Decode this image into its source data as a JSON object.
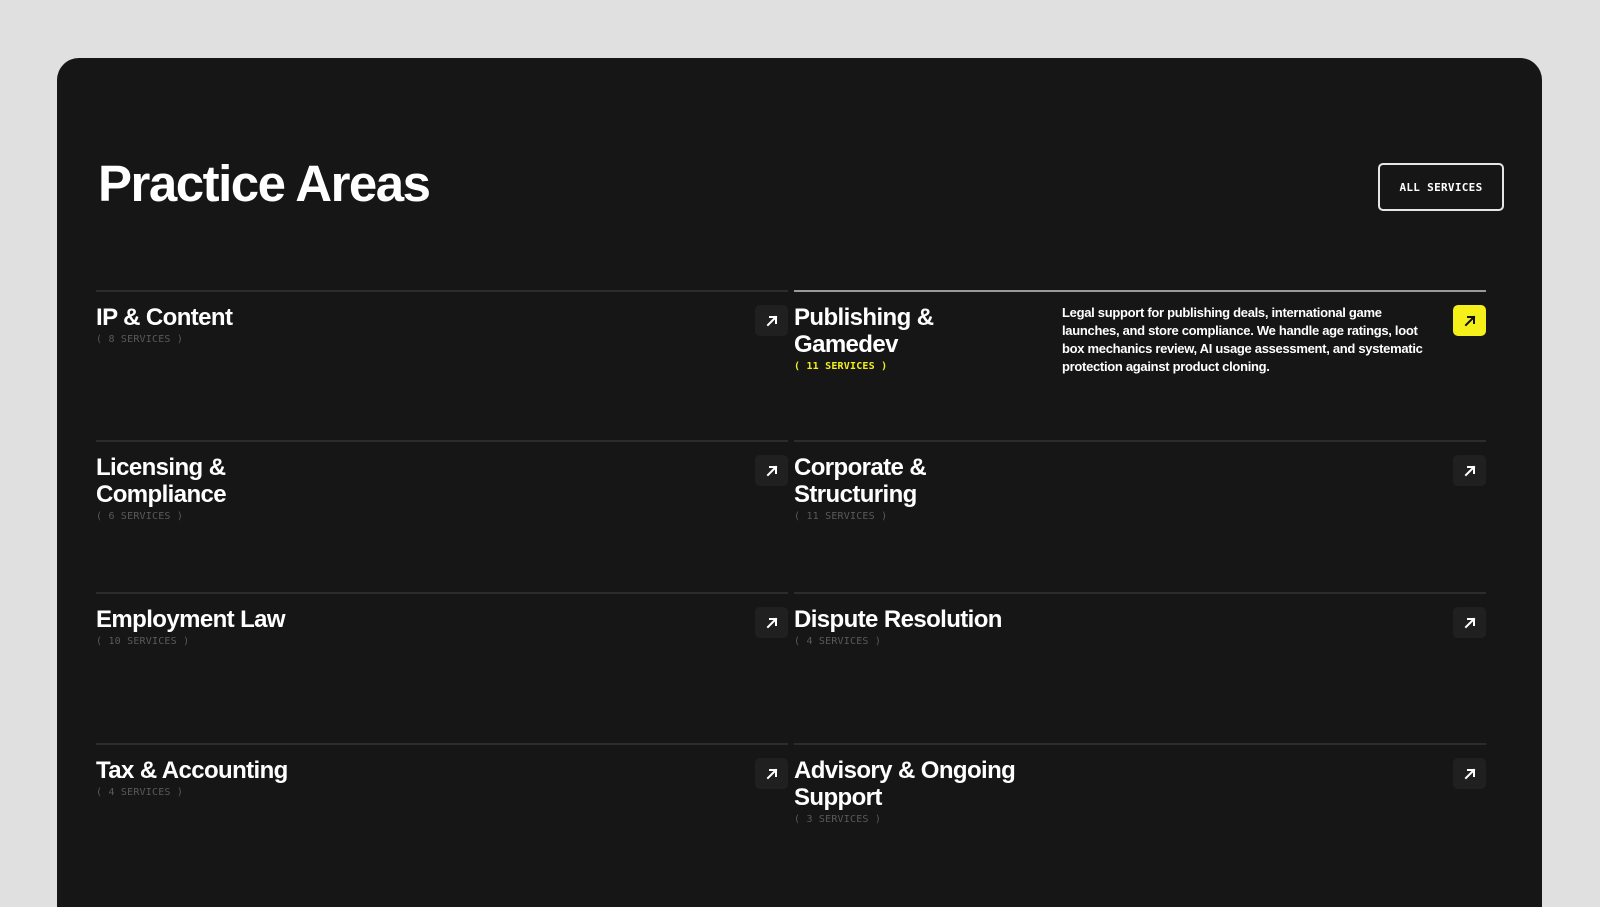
{
  "section": {
    "title": "Practice Areas",
    "all_services_label": "ALL SERVICES"
  },
  "areas": [
    {
      "title": "IP & Content",
      "count": "( 8 SERVICES )"
    },
    {
      "title": "Publishing & Gamedev",
      "count": "( 11 SERVICES )",
      "active": true,
      "description": "Legal support for publishing deals, international game launches, and store compliance. We handle age ratings, loot box mechanics review, AI usage assessment, and systematic protection against product cloning."
    },
    {
      "title": "Licensing & Compliance",
      "count": "( 6 SERVICES )"
    },
    {
      "title": "Corporate & Structuring",
      "count": "( 11 SERVICES )"
    },
    {
      "title": "Employment Law",
      "count": "( 10 SERVICES )"
    },
    {
      "title": "Dispute Resolution",
      "count": "( 4 SERVICES )"
    },
    {
      "title": "Tax & Accounting",
      "count": "( 4 SERVICES )"
    },
    {
      "title": "Advisory & Ongoing Support",
      "count": "( 3 SERVICES )"
    }
  ],
  "icons": {
    "arrow": "arrow-up-right-icon"
  },
  "colors": {
    "accent": "#f5ef1a",
    "panel": "#161616",
    "page": "#e0e0e0"
  }
}
